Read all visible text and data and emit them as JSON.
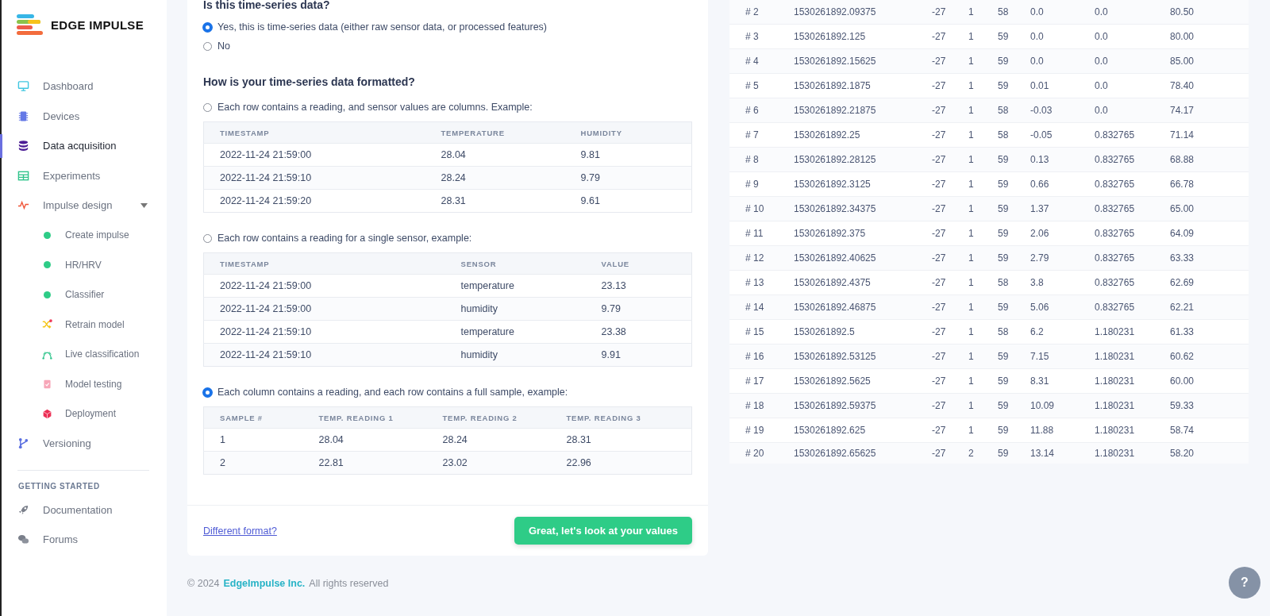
{
  "sidebar": {
    "logo_text": "EDGE IMPULSE",
    "items": [
      {
        "label": "Dashboard",
        "selected": false
      },
      {
        "label": "Devices",
        "selected": false
      },
      {
        "label": "Data acquisition",
        "selected": true
      },
      {
        "label": "Experiments",
        "selected": false
      },
      {
        "label": "Impulse design",
        "selected": false,
        "expanded": true,
        "children": [
          {
            "label": "Create impulse",
            "kind": "dot",
            "selected": false
          },
          {
            "label": "HR/HRV",
            "kind": "dot",
            "selected": false
          },
          {
            "label": "Classifier",
            "kind": "dot",
            "selected": false
          },
          {
            "label": "Retrain model",
            "kind": "icon",
            "selected": false
          },
          {
            "label": "Live classification",
            "kind": "icon",
            "selected": false
          },
          {
            "label": "Model testing",
            "kind": "icon",
            "selected": false
          },
          {
            "label": "Deployment",
            "kind": "icon",
            "selected": false
          }
        ]
      },
      {
        "label": "Versioning",
        "selected": false
      }
    ],
    "section_title": "GETTING STARTED",
    "section_items": [
      {
        "label": "Documentation",
        "selected": false
      },
      {
        "label": "Forums",
        "selected": false
      }
    ]
  },
  "wizard": {
    "question": "Is this time-series data?",
    "answers": [
      {
        "label": "Yes, this is time-series data (either raw sensor data, or processed features)",
        "selected": true
      },
      {
        "label": "No",
        "selected": false
      }
    ],
    "format_question": "How is your time-series data formatted?",
    "formats": [
      {
        "label": "Each row contains a reading, and sensor values are columns. Example:",
        "selected": false,
        "table": {
          "columns": [
            "TIMESTAMP",
            "TEMPERATURE",
            "HUMIDITY"
          ],
          "rows": [
            [
              "2022-11-24 21:59:00",
              "28.04",
              "9.81"
            ],
            [
              "2022-11-24 21:59:10",
              "28.24",
              "9.79"
            ],
            [
              "2022-11-24 21:59:20",
              "28.31",
              "9.61"
            ]
          ]
        }
      },
      {
        "label": "Each row contains a reading for a single sensor, example:",
        "selected": false,
        "table": {
          "columns": [
            "TIMESTAMP",
            "SENSOR",
            "VALUE"
          ],
          "rows": [
            [
              "2022-11-24 21:59:00",
              "temperature",
              "23.13"
            ],
            [
              "2022-11-24 21:59:00",
              "humidity",
              "9.79"
            ],
            [
              "2022-11-24 21:59:10",
              "temperature",
              "23.38"
            ],
            [
              "2022-11-24 21:59:10",
              "humidity",
              "9.91"
            ]
          ]
        }
      },
      {
        "label": "Each column contains a reading, and each row contains a full sample, example:",
        "selected": true,
        "table": {
          "columns": [
            "SAMPLE #",
            "TEMP. READING 1",
            "TEMP. READING 2",
            "TEMP. READING 3"
          ],
          "rows": [
            [
              "1",
              "28.04",
              "28.24",
              "28.31"
            ],
            [
              "2",
              "22.81",
              "23.02",
              "22.96"
            ]
          ]
        }
      }
    ],
    "link": "Different format?",
    "button": "Great, let's look at your values"
  },
  "preview_table": {
    "rows": [
      [
        "# 2",
        "1530261892.09375",
        "-27",
        "1",
        "58",
        "0.0",
        "0.0",
        "80.50"
      ],
      [
        "# 3",
        "1530261892.125",
        "-27",
        "1",
        "59",
        "0.0",
        "0.0",
        "80.00"
      ],
      [
        "# 4",
        "1530261892.15625",
        "-27",
        "1",
        "59",
        "0.0",
        "0.0",
        "85.00"
      ],
      [
        "# 5",
        "1530261892.1875",
        "-27",
        "1",
        "59",
        "0.01",
        "0.0",
        "78.40"
      ],
      [
        "# 6",
        "1530261892.21875",
        "-27",
        "1",
        "58",
        "-0.03",
        "0.0",
        "74.17"
      ],
      [
        "# 7",
        "1530261892.25",
        "-27",
        "1",
        "58",
        "-0.05",
        "0.832765",
        "71.14"
      ],
      [
        "# 8",
        "1530261892.28125",
        "-27",
        "1",
        "59",
        "0.13",
        "0.832765",
        "68.88"
      ],
      [
        "# 9",
        "1530261892.3125",
        "-27",
        "1",
        "59",
        "0.66",
        "0.832765",
        "66.78"
      ],
      [
        "# 10",
        "1530261892.34375",
        "-27",
        "1",
        "59",
        "1.37",
        "0.832765",
        "65.00"
      ],
      [
        "# 11",
        "1530261892.375",
        "-27",
        "1",
        "59",
        "2.06",
        "0.832765",
        "64.09"
      ],
      [
        "# 12",
        "1530261892.40625",
        "-27",
        "1",
        "59",
        "2.79",
        "0.832765",
        "63.33"
      ],
      [
        "# 13",
        "1530261892.4375",
        "-27",
        "1",
        "58",
        "3.8",
        "0.832765",
        "62.69"
      ],
      [
        "# 14",
        "1530261892.46875",
        "-27",
        "1",
        "59",
        "5.06",
        "0.832765",
        "62.21"
      ],
      [
        "# 15",
        "1530261892.5",
        "-27",
        "1",
        "58",
        "6.2",
        "1.180231",
        "61.33"
      ],
      [
        "# 16",
        "1530261892.53125",
        "-27",
        "1",
        "59",
        "7.15",
        "1.180231",
        "60.62"
      ],
      [
        "# 17",
        "1530261892.5625",
        "-27",
        "1",
        "59",
        "8.31",
        "1.180231",
        "60.00"
      ],
      [
        "# 18",
        "1530261892.59375",
        "-27",
        "1",
        "59",
        "10.09",
        "1.180231",
        "59.33"
      ],
      [
        "# 19",
        "1530261892.625",
        "-27",
        "1",
        "59",
        "11.88",
        "1.180231",
        "58.74"
      ],
      [
        "# 20",
        "1530261892.65625",
        "-27",
        "2",
        "59",
        "13.14",
        "1.180231",
        "58.20"
      ]
    ]
  },
  "footer": {
    "year": "© 2024",
    "company": "EdgeImpulse Inc.",
    "rights": "All rights reserved"
  },
  "help_button": {
    "symbol": "?"
  }
}
